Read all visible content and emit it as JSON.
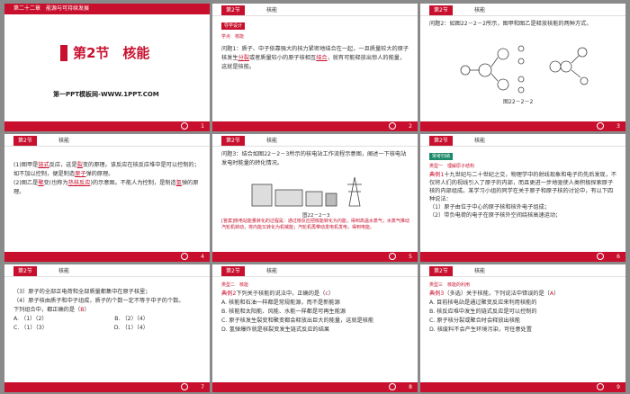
{
  "s1": {
    "header": "第二十二章　能源与可持续发展",
    "title": "第2节　核能",
    "site": "第一PPT模板网-WWW.1PPT.COM",
    "page": "1"
  },
  "s2": {
    "tag": "第2节",
    "title": "核能",
    "badge": "导学设计",
    "sub": "学点　核能",
    "q": "问题1：质子、中子依靠强大的核力紧密地结合在一起，一旦质量较大的原子核发生",
    "b1": "分裂",
    "q2": "或者质量较小的原子核相互",
    "b2": "结合",
    "q3": "，就有可能释放出惊人的能量，这就是核能。",
    "page": "2"
  },
  "s3": {
    "tag": "第2节",
    "title": "核能",
    "q": "问题2：如图22－2－2所示，图甲和图乙是释放核能的两种方式。",
    "cap": "图22－2－2",
    "page": "3"
  },
  "s4": {
    "tag": "第2节",
    "title": "核能",
    "l1": "(1)图甲是",
    "b1": "链式",
    "l1b": "反应，这是",
    "b2": "裂",
    "l1c": "变的原理。该反应在核反应堆中是可以控制的；如不加以控制，便是制造",
    "b3": "原子",
    "l1d": "弹的原理。",
    "l2": "(2)图乙是",
    "b4": "聚",
    "l2b": "变(也称为",
    "b5": "热核反应",
    "l2c": ")的示意图。不能人为控制，是制造",
    "b6": "氢",
    "l2d": "弹的原理。",
    "page": "4"
  },
  "s5": {
    "tag": "第2节",
    "title": "核能",
    "q": "问题3：结合如图22－2－3所示的核电站工作流程示意图，阐述一下核电站发电时能量的转化情况。",
    "cap": "图22－2－3",
    "ans": "[答案]核电站能量转化的过程是：通过核反应把核能转化为内能，得到高温水蒸气；水蒸气推动汽轮机转动，将内能又转化为机械能；汽轮机再带动发电机发电，得到电能。",
    "page": "5"
  },
  "s6": {
    "tag": "第2节",
    "title": "核能",
    "badge": "常考归纳",
    "sub": "类型一　理解原子结构",
    "p1": "典例1",
    "p1t": "十九世纪与二十世纪之交，物理学中的射线现象和电子的先后发现，不仅将人们的视线引入了原子的内部，而且更进一步地驱使人类积极探索原子核的内部组成。某学习小组的同学在关于原子和原子核的讨论中，有以下四种说法：",
    "o1": "（1）原子由位于中心的原子核和核外电子组成；",
    "o2": "（2）带负电荷的电子在原子核外空间绕核高速运动；",
    "page": "6"
  },
  "s7": {
    "tag": "第2节",
    "title": "核能",
    "o3": "（3）原子的全部正电荷和全部质量都集中在原子核里；",
    "o4": "（4）原子核由质子和中子组成，质子的个数一定不等于中子的个数。",
    "q": "下列组合中，都正确的是（",
    "ans": "B",
    "q2": "）",
    "a": "A. （1）（2）",
    "b": "B. （2）（4）",
    "c": "C. （1）（3）",
    "d": "D. （1）（4）",
    "page": "7"
  },
  "s8": {
    "tag": "第2节",
    "title": "核能",
    "sub": "类型二　核能",
    "p": "典例2",
    "pt": "下列关于核能的说法中，正确的是（",
    "ans": "c",
    "pt2": "）",
    "a": "A. 核能和石油一样都是常规能源，而不是新能源",
    "b": "B. 核能和太阳能、风能、水能一样都是可再生能源",
    "c": "C. 原子核发生裂变和聚变都会释放出巨大的能量，这就是核能",
    "d": "D. 氢弹爆炸就是核裂变发生链式反应的结果",
    "page": "8"
  },
  "s9": {
    "tag": "第2节",
    "title": "核能",
    "sub": "类型三　核能的利用",
    "p": "典例3",
    "pt": "（多选）关于核能，下列说法中错误的是（",
    "ans": "A",
    "pt2": "）",
    "a": "A. 目前核电站是通过聚变反应来利用核能的",
    "b": "B. 核反应堆中发生的链式反应是可以控制的",
    "c": "C. 原子核分裂或聚合时会释放出核能",
    "d": "D. 核废料不会产生环境污染，可任意处置",
    "page": "9"
  }
}
